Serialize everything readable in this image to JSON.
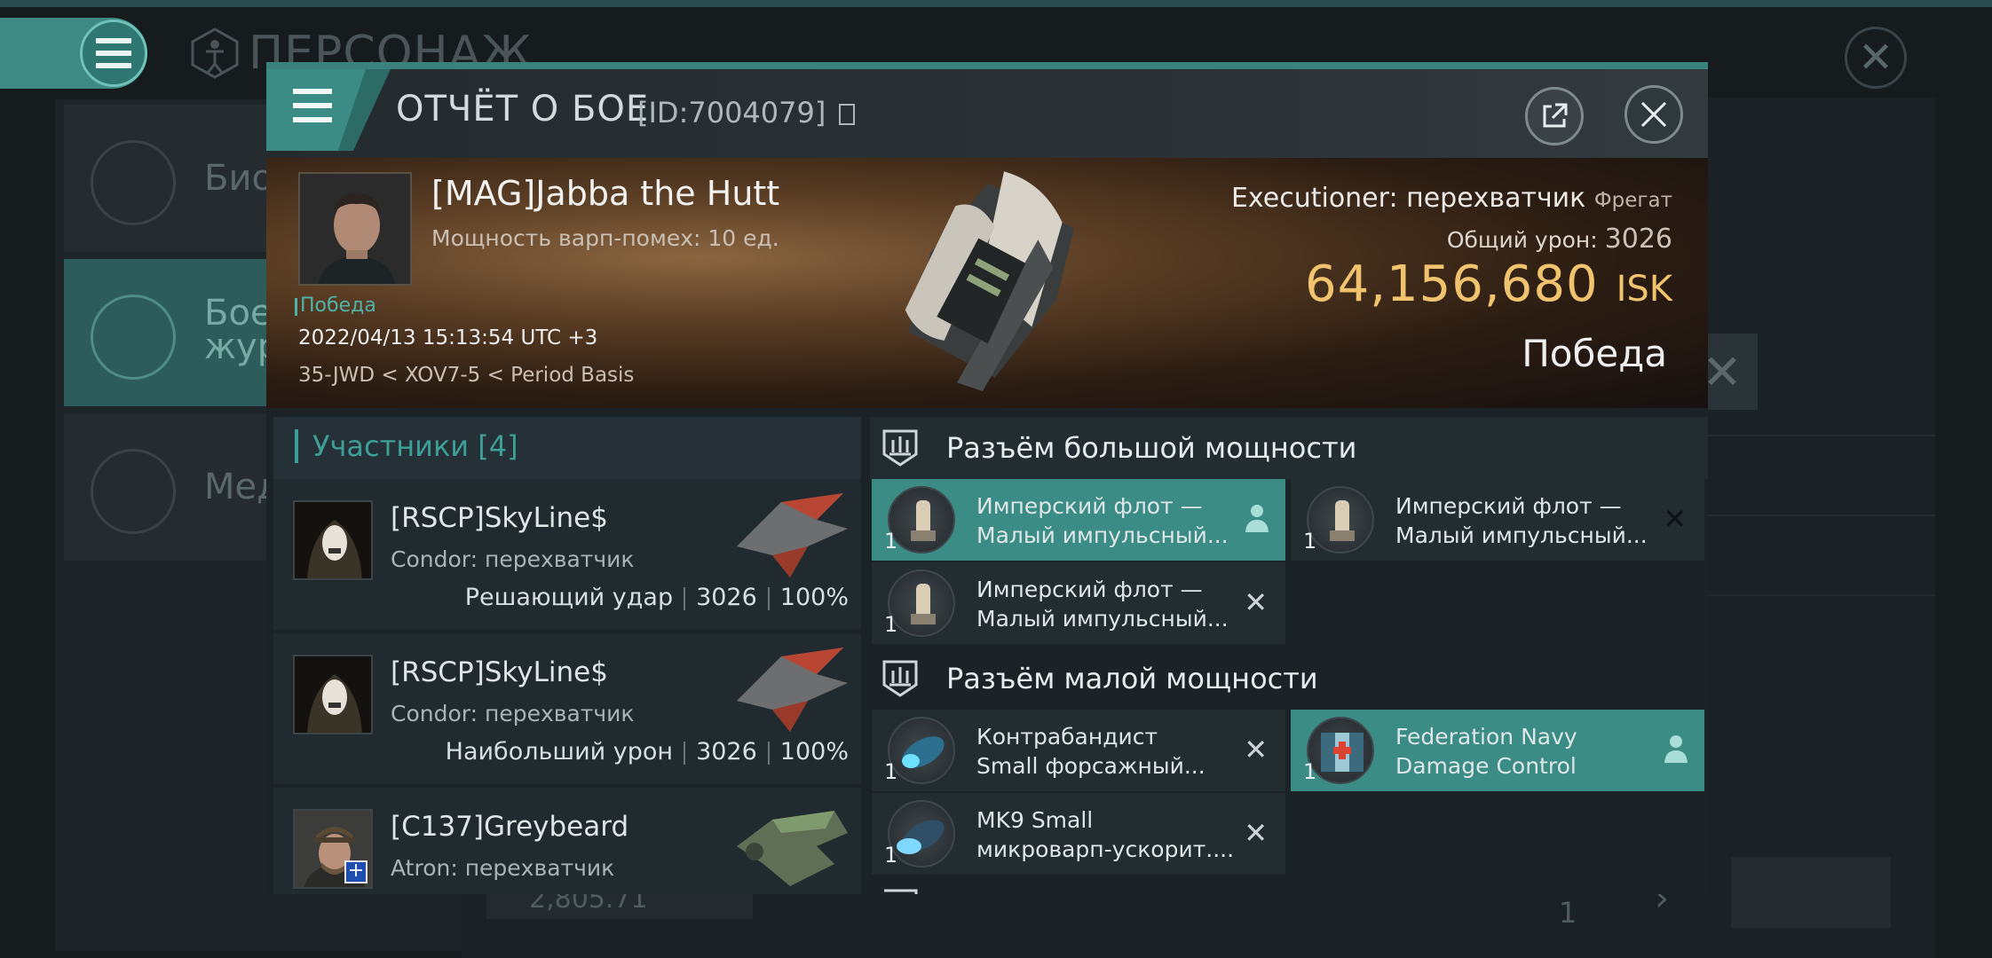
{
  "background": {
    "title": "ПЕРСОНАЖ",
    "left_items": [
      {
        "label": "Био"
      },
      {
        "label": "Бое\nжур"
      },
      {
        "label": "Мед"
      }
    ],
    "price": "2,805.71",
    "page_number": "1"
  },
  "report": {
    "title": "ОТЧЁТ О БОЕ",
    "id": "[ID:7004079]"
  },
  "battle": {
    "pilot_name": "[MAG]Jabba the Hutt",
    "warp_disrupt": "Мощность варп-помех: 10 ед.",
    "result_small": "Победа",
    "datetime": "2022/04/13 15:13:54 UTC +3",
    "location": "35-JWD < XOV7-5 < Period Basis",
    "ship": "Executioner: перехватчик",
    "ship_class": "Фрегат",
    "total_damage_label": "Общий урон:",
    "total_damage": "3026",
    "isk_value": "64,156,680",
    "isk_unit": "ISK",
    "result_big": "Победа"
  },
  "participants": {
    "header": "Участники [4]",
    "rows": [
      {
        "name": "[RSCP]SkyLine$",
        "ship": "Condor: перехватчик",
        "role": "Решающий удар",
        "damage": "3026",
        "percent": "100%"
      },
      {
        "name": "[RSCP]SkyLine$",
        "ship": "Condor: перехватчик",
        "role": "Наибольший урон",
        "damage": "3026",
        "percent": "100%"
      },
      {
        "name": "[C137]Greybeard",
        "ship": "Atron: перехватчик",
        "role": "",
        "damage": "",
        "percent": ""
      }
    ]
  },
  "fitting": {
    "high_slot_title": "Разъём большой мощности",
    "high_modules": [
      {
        "qty": "1",
        "line1": "Имперский флот —",
        "line2": "Малый импульсный...",
        "state": "pilot"
      },
      {
        "qty": "1",
        "line1": "Имперский флот —",
        "line2": "Малый импульсный...",
        "state": "destroyed"
      },
      {
        "qty": "1",
        "line1": "Имперский флот —",
        "line2": "Малый импульсный...",
        "state": "destroyed"
      }
    ],
    "low_slot_title": "Разъём малой мощности",
    "low_modules": [
      {
        "qty": "1",
        "line1": "Контрабандист",
        "line2": "Small форсажный...",
        "state": "destroyed"
      },
      {
        "qty": "1",
        "line1": "Federation Navy",
        "line2": "Damage Control",
        "state": "pilot"
      },
      {
        "qty": "1",
        "line1": "MK9 Small",
        "line2": "микроварп-ускорит....",
        "state": "destroyed"
      }
    ],
    "destroyed_mark": "✕"
  },
  "colors": {
    "accent": "#3a8c85",
    "isk": "#f1c36e"
  }
}
